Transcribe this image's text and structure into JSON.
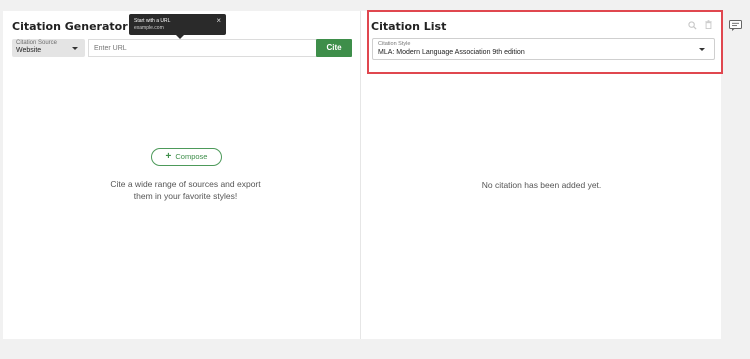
{
  "generator": {
    "title": "Citation Generator",
    "source_label": "Citation Source",
    "source_value": "Website",
    "url_placeholder": "Enter URL",
    "cite_label": "Cite",
    "tooltip_title": "Start with a URL",
    "tooltip_sub": "example.com",
    "tooltip_close": "×",
    "compose_label": "Compose",
    "empty_line1": "Cite a wide range of sources and export",
    "empty_line2": "them in your favorite styles!"
  },
  "citation_list": {
    "title": "Citation List",
    "style_label": "Citation Style",
    "style_value": "MLA: Modern Language Association 9th edition",
    "empty_message": "No citation has been added yet."
  },
  "icons": {
    "search": "search-icon",
    "trash": "trash-icon",
    "chat": "chat-icon"
  },
  "colors": {
    "accent_green": "#3e8e4a",
    "highlight_red": "#e0474f",
    "tooltip_bg": "#2a2a2a"
  }
}
